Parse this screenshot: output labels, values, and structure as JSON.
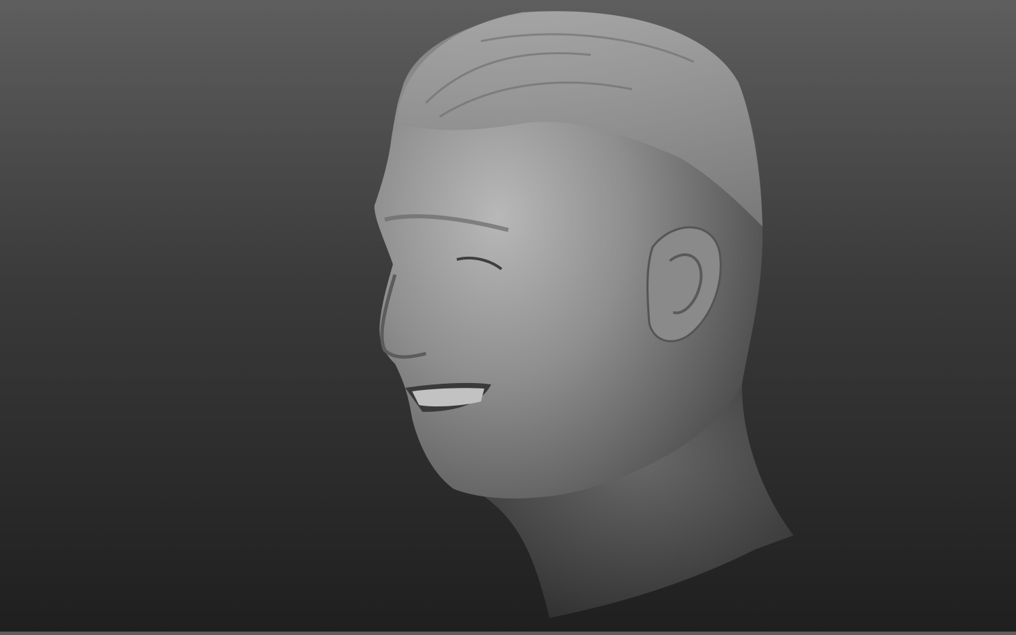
{
  "scene": {
    "subject": "3d-head-sculpt",
    "colors": {
      "background_top": "#5e5e5e",
      "background_bottom": "#1f1f1f",
      "model_base": "#8c8c8c",
      "model_highlight": "#b5b5b5",
      "model_shadow": "#4a4a4a"
    }
  }
}
